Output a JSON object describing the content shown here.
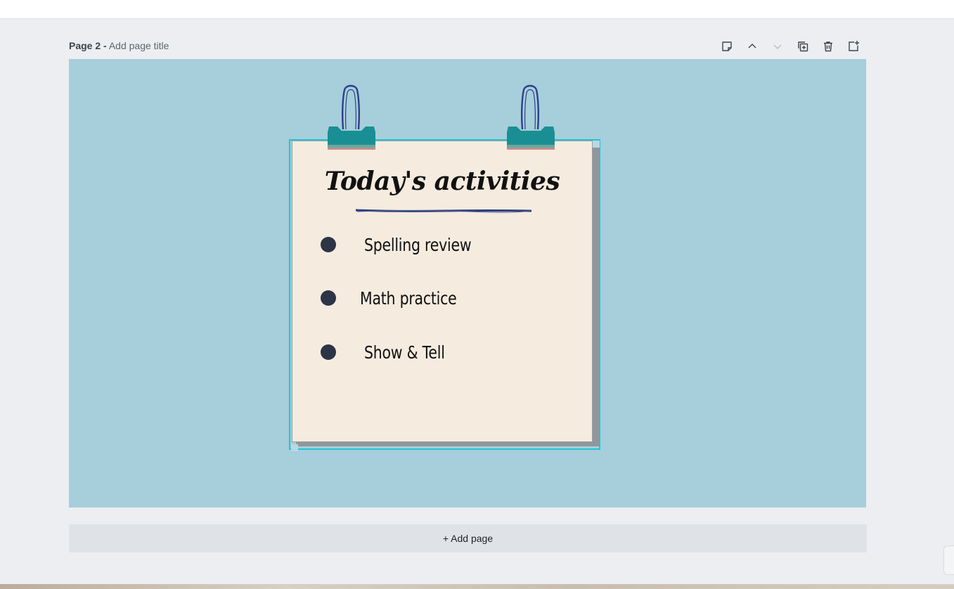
{
  "page_header": {
    "page_number": "Page 2 -",
    "title_placeholder": "Add page title"
  },
  "toolbar": {
    "tools": [
      {
        "name": "notes-icon",
        "label": "Notes"
      },
      {
        "name": "move-up-icon",
        "label": "Move page up"
      },
      {
        "name": "move-down-icon",
        "label": "Move page down"
      },
      {
        "name": "duplicate-icon",
        "label": "Duplicate page"
      },
      {
        "name": "trash-icon",
        "label": "Delete page"
      },
      {
        "name": "add-page-icon",
        "label": "Add page"
      }
    ]
  },
  "note": {
    "title": "Today's activities",
    "items": [
      "Spelling review",
      "Math practice",
      "Show & Tell"
    ]
  },
  "add_page_label": "+ Add page",
  "colors": {
    "canvas": "#a6cedb",
    "note": "#f5ebdf",
    "selection": "#21c4d6",
    "clip_teal": "#1a8f93",
    "clip_wire": "#2f3f8a",
    "bullet": "#2c3446"
  }
}
